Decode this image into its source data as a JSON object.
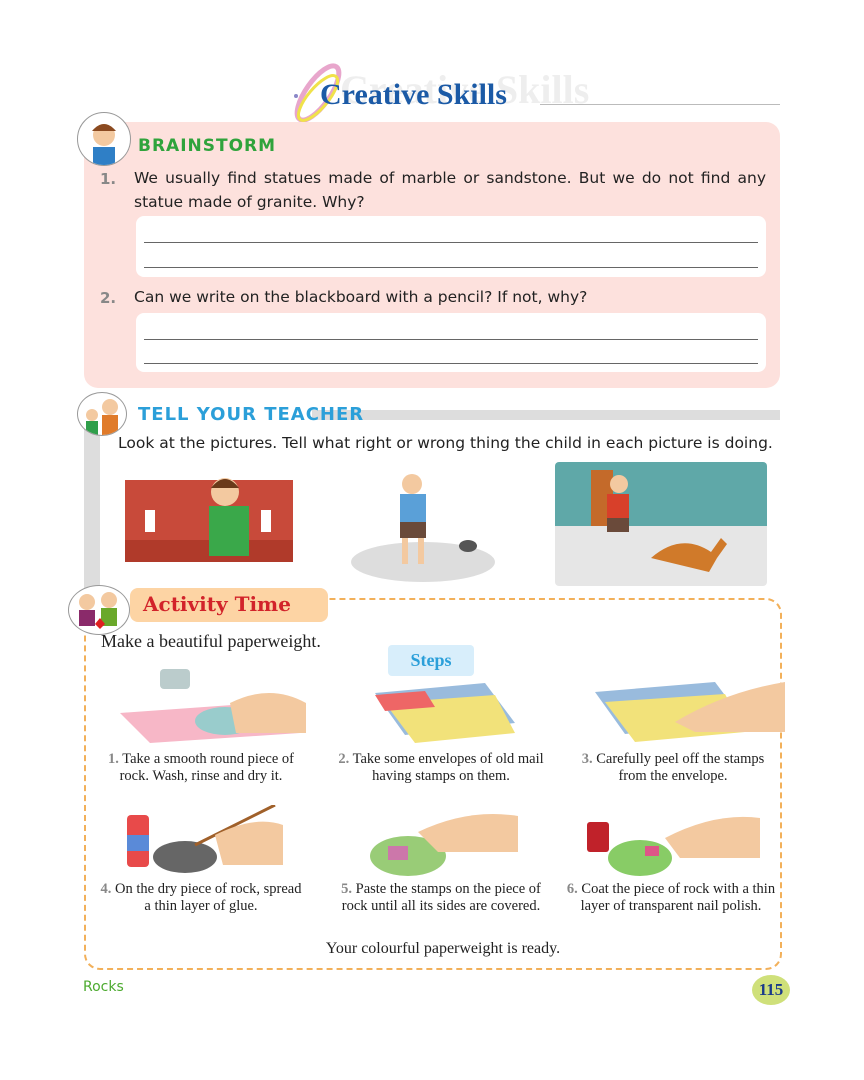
{
  "header": {
    "title": "Creative Skills",
    "title_watermark": "Creative Skills"
  },
  "brainstorm": {
    "heading": "BRAINSTORM",
    "questions": [
      {
        "num": "1.",
        "text": "We usually find statues made of marble or sandstone. But we do not find any statue made of granite. Why?"
      },
      {
        "num": "2.",
        "text": "Can we write on the blackboard with a pencil? If not, why?"
      }
    ]
  },
  "tell_teacher": {
    "heading": "TELL YOUR TEACHER",
    "instruction": "Look at the pictures. Tell what right or wrong thing the child in each picture is doing."
  },
  "activity": {
    "heading": "Activity Time",
    "intro": "Make a beautiful paperweight.",
    "steps_label": "Steps",
    "steps": [
      {
        "num": "1.",
        "text": "Take a smooth round piece of rock. Wash, rinse and dry it."
      },
      {
        "num": "2.",
        "text": "Take some envelopes of old mail having stamps on them."
      },
      {
        "num": "3.",
        "text": "Carefully peel off the stamps from the envelope."
      },
      {
        "num": "4.",
        "text": "On the dry piece of rock, spread a thin layer of glue."
      },
      {
        "num": "5.",
        "text": "Paste the stamps on the piece of rock until all its sides are covered."
      },
      {
        "num": "6.",
        "text": "Coat the piece of rock with a thin layer of transparent nail polish."
      }
    ],
    "conclusion": "Your colourful paperweight is ready."
  },
  "footer": {
    "chapter": "Rocks",
    "page_number": "115"
  },
  "colors": {
    "title": "#1b5aa6",
    "brainstorm_bg": "#fde1dd",
    "brainstorm_heading": "#2fa33c",
    "teacher_heading": "#2b9fd9",
    "activity_heading": "#d2232a",
    "activity_border": "#f2b05a"
  }
}
